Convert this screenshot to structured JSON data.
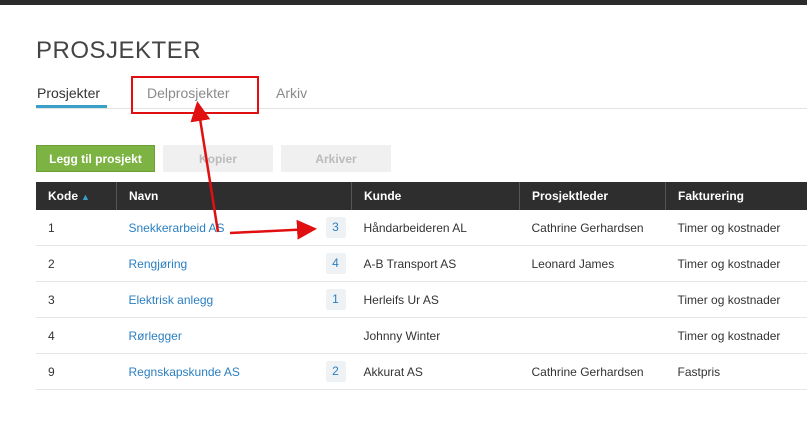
{
  "header": {
    "title": "PROSJEKTER"
  },
  "tabs": [
    {
      "label": "Prosjekter",
      "active": true
    },
    {
      "label": "Delprosjekter",
      "active": false
    },
    {
      "label": "Arkiv",
      "active": false
    }
  ],
  "toolbar": {
    "add_label": "Legg til prosjekt",
    "copy_label": "Kopier",
    "archive_label": "Arkiver"
  },
  "table": {
    "columns": [
      "Kode",
      "Navn",
      "Kunde",
      "Prosjektleder",
      "Fakturering"
    ],
    "sort_icon": "sort-asc-icon",
    "rows": [
      {
        "kode": "1",
        "navn": "Snekkerarbeid AS",
        "count": "3",
        "kunde": "Håndarbeideren AL",
        "leder": "Cathrine Gerhardsen",
        "fakturering": "Timer og kostnader"
      },
      {
        "kode": "2",
        "navn": "Rengjøring",
        "count": "4",
        "kunde": "A-B Transport AS",
        "leder": "Leonard James",
        "fakturering": "Timer og kostnader"
      },
      {
        "kode": "3",
        "navn": "Elektrisk anlegg",
        "count": "1",
        "kunde": "Herleifs Ur AS",
        "leder": "",
        "fakturering": "Timer og kostnader"
      },
      {
        "kode": "4",
        "navn": "Rørlegger",
        "count": "",
        "kunde": "Johnny Winter",
        "leder": "",
        "fakturering": "Timer og kostnader"
      },
      {
        "kode": "9",
        "navn": "Regnskapskunde AS",
        "count": "2",
        "kunde": "Akkurat AS",
        "leder": "Cathrine Gerhardsen",
        "fakturering": "Fastpris"
      }
    ]
  },
  "colors": {
    "accent": "#3aa0c8",
    "link": "#2b7fc1",
    "add_button": "#7cb342",
    "header_bg": "#2e2e2e",
    "annotation": "#e01010"
  }
}
